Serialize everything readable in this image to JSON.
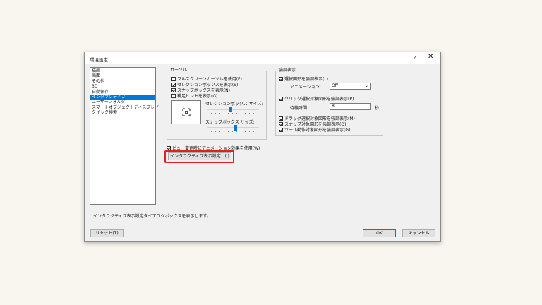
{
  "window": {
    "title": "環境設定",
    "help_label": "?",
    "close_label": "✕"
  },
  "categories": [
    {
      "label": "描画",
      "selected": false
    },
    {
      "label": "画面",
      "selected": false
    },
    {
      "label": "その他",
      "selected": false
    },
    {
      "label": "3D",
      "selected": false
    },
    {
      "label": "自動保存",
      "selected": false
    },
    {
      "label": "インタラクティブ",
      "selected": true
    },
    {
      "label": "ユーザーフォルダ",
      "selected": false
    },
    {
      "label": "スマートオブジェクトディスプレイ",
      "selected": false
    },
    {
      "label": "クイック検索",
      "selected": false
    }
  ],
  "cursor_group": {
    "title": "カーソル",
    "options": [
      {
        "label": "フルスクリーンカーソルを使用(F)",
        "checked": false
      },
      {
        "label": "セレクションボックスを表示(S)",
        "checked": true
      },
      {
        "label": "スナップボックスを表示(N)",
        "checked": true
      },
      {
        "label": "補足ヒントを表示(G)",
        "checked": false
      }
    ],
    "selection_box_size_label": "セレクションボックス サイズ:",
    "selection_box_size_level": 0.45,
    "snap_box_size_label": "スナップボックス サイズ:",
    "snap_box_size_level": 0.55
  },
  "highlight_group": {
    "title": "強調表示",
    "hover_highlight": {
      "label": "選択図形を強調表示(L)",
      "checked": true
    },
    "animation_label": "アニメーション:",
    "animation_value": "Off",
    "click_highlight": {
      "label": "クリック選択対象図形を強調表示(P)",
      "checked": true
    },
    "wait_time_label": "待機時間",
    "wait_time_value": "8",
    "wait_time_unit": "秒",
    "more_options": [
      {
        "label": "ドラッグ選択対象図形を強調表示(M)",
        "checked": true
      },
      {
        "label": "スナップ対象図形を強調表示(O)",
        "checked": true
      },
      {
        "label": "ツール動作対象図形を強調表示(G)",
        "checked": true
      }
    ]
  },
  "view_change_animation": {
    "label": "ビュー変更時にアニメーション効果を使用(W)",
    "checked": true
  },
  "interactive_settings_button": "インタラクティブ表示設定...(I)",
  "description": "インタラクティブ表示設定ダイアログボックスを表示します。",
  "buttons": {
    "reset": "リセット(T)",
    "ok": "OK",
    "cancel": "キャンセル"
  },
  "colors": {
    "accent": "#0078d7",
    "highlight_box": "#e02020"
  }
}
